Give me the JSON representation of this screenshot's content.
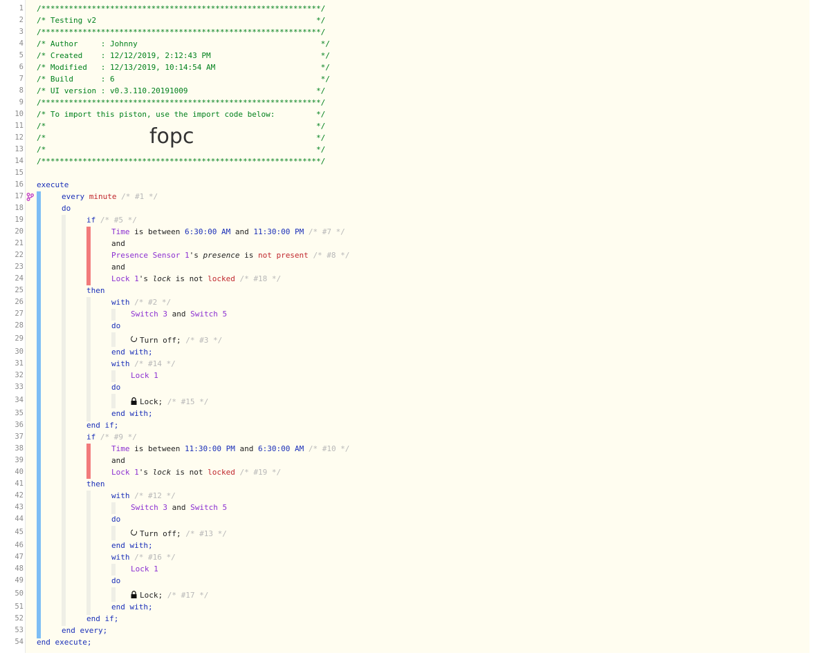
{
  "header": {
    "border": "/*************************************************************/",
    "title": "/* Testing v2                                                */",
    "author": "/* Author     : Johnny                                        */",
    "created": "/* Created    : 12/12/2019, 2:12:43 PM                        */",
    "modified": "/* Modified   : 12/13/2019, 10:14:54 AM                       */",
    "build": "/* Build      : 6                                             */",
    "ui_version": "/* UI version : v0.3.110.20191009                            */",
    "import_note": "/* To import this piston, use the import code below:         */",
    "blank": "/*                                                           */",
    "import_code": "fopc"
  },
  "code": {
    "execute": "execute",
    "every": "every",
    "minute": "minute",
    "c1": "/* #1 */",
    "do": "do",
    "if": "if",
    "c5": "/* #5 */",
    "time": "Time",
    "is_between": "is between",
    "t_630am": "6:30:00 AM",
    "and": "and",
    "t_1130pm": "11:30:00 PM",
    "c7": "/* #7 */",
    "presence_sensor": "Presence Sensor 1",
    "apos_s": "'s",
    "presence": "presence",
    "is": "is",
    "not_present": "not present",
    "c8": "/* #8 */",
    "lock1": "Lock 1",
    "lock_attr": "lock",
    "is_not": "is not",
    "locked": "locked",
    "c18": "/* #18 */",
    "then": "then",
    "with": "with",
    "c2": "/* #2 */",
    "switch3": "Switch 3",
    "switch5": "Switch 5",
    "turn_off": "Turn off;",
    "c3": "/* #3 */",
    "end_with": "end with;",
    "c14": "/* #14 */",
    "lock_cmd": "Lock;",
    "c15": "/* #15 */",
    "end_if": "end if;",
    "c9": "/* #9 */",
    "c10": "/* #10 */",
    "c19": "/* #19 */",
    "c12": "/* #12 */",
    "c13": "/* #13 */",
    "c16": "/* #16 */",
    "c17": "/* #17 */",
    "end_every": "end every;",
    "end_execute": "end execute;"
  },
  "line_numbers": [
    "1",
    "2",
    "3",
    "4",
    "5",
    "6",
    "7",
    "8",
    "9",
    "10",
    "11",
    "12",
    "13",
    "14",
    "15",
    "16",
    "17",
    "18",
    "19",
    "20",
    "21",
    "22",
    "23",
    "24",
    "25",
    "26",
    "27",
    "28",
    "29",
    "30",
    "31",
    "32",
    "33",
    "34",
    "35",
    "36",
    "37",
    "38",
    "39",
    "40",
    "41",
    "42",
    "43",
    "44",
    "45",
    "46",
    "47",
    "48",
    "49",
    "50",
    "51",
    "52",
    "53",
    "54"
  ],
  "colors": {
    "header_green": "#00801c",
    "keyword_blue": "#1a2fb8",
    "device_purple": "#8b2fd1",
    "value_red": "#c0272d",
    "comment_gray": "#b8b8b8",
    "bar_blue": "#7dbdf5",
    "bar_red": "#f27b7b"
  },
  "icons": {
    "branch": "branch-icon",
    "power": "power-icon",
    "lock": "lock-icon"
  }
}
